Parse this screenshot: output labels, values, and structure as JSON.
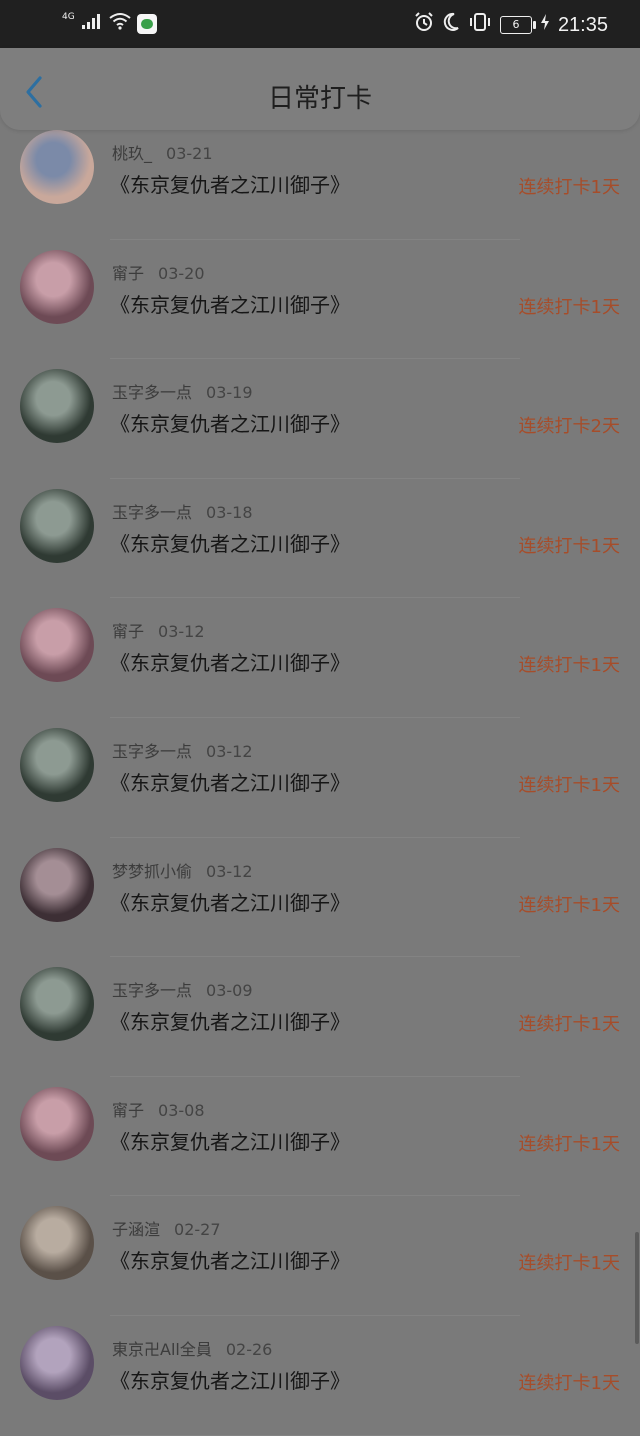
{
  "status_bar": {
    "network": "4G",
    "battery": "6",
    "time": "21:35",
    "icons": [
      "signal-icon",
      "wifi-icon",
      "app-notification-icon",
      "alarm-icon",
      "moon-icon",
      "vibrate-icon",
      "battery-icon",
      "charging-icon"
    ]
  },
  "header": {
    "title": "日常打卡",
    "back_icon": "chevron-left-icon"
  },
  "entries": [
    {
      "user": "桃玖_",
      "date": "03-21",
      "book": "《东京复仇者之江川御子》",
      "streak": "连续打卡1天",
      "avatar_colors": [
        "#c9a89b",
        "#7b8aa8"
      ]
    },
    {
      "user": "甯子",
      "date": "03-20",
      "book": "《东京复仇者之江川御子》",
      "streak": "连续打卡1天",
      "avatar_colors": [
        "#6d4a55",
        "#c89ea8"
      ]
    },
    {
      "user": "玉字多一点",
      "date": "03-19",
      "book": "《东京复仇者之江川御子》",
      "streak": "连续打卡2天",
      "avatar_colors": [
        "#2f3a33",
        "#8d9a92"
      ]
    },
    {
      "user": "玉字多一点",
      "date": "03-18",
      "book": "《东京复仇者之江川御子》",
      "streak": "连续打卡1天",
      "avatar_colors": [
        "#2f3a33",
        "#8d9a92"
      ]
    },
    {
      "user": "甯子",
      "date": "03-12",
      "book": "《东京复仇者之江川御子》",
      "streak": "连续打卡1天",
      "avatar_colors": [
        "#6d4a55",
        "#c89ea8"
      ]
    },
    {
      "user": "玉字多一点",
      "date": "03-12",
      "book": "《东京复仇者之江川御子》",
      "streak": "连续打卡1天",
      "avatar_colors": [
        "#2f3a33",
        "#8d9a92"
      ]
    },
    {
      "user": "梦梦抓小偷",
      "date": "03-12",
      "book": "《东京复仇者之江川御子》",
      "streak": "连续打卡1天",
      "avatar_colors": [
        "#3d2f35",
        "#a48e95"
      ]
    },
    {
      "user": "玉字多一点",
      "date": "03-09",
      "book": "《东京复仇者之江川御子》",
      "streak": "连续打卡1天",
      "avatar_colors": [
        "#2f3a33",
        "#8d9a92"
      ]
    },
    {
      "user": "甯子",
      "date": "03-08",
      "book": "《东京复仇者之江川御子》",
      "streak": "连续打卡1天",
      "avatar_colors": [
        "#6d4a55",
        "#c89ea8"
      ]
    },
    {
      "user": "子涵渲",
      "date": "02-27",
      "book": "《东京复仇者之江川御子》",
      "streak": "连续打卡1天",
      "avatar_colors": [
        "#5a5048",
        "#b8aca0"
      ]
    },
    {
      "user": "東京卍All全員",
      "date": "02-26",
      "book": "《东京复仇者之江川御子》",
      "streak": "连续打卡1天",
      "avatar_colors": [
        "#5b4d66",
        "#b2a3bd"
      ]
    }
  ]
}
